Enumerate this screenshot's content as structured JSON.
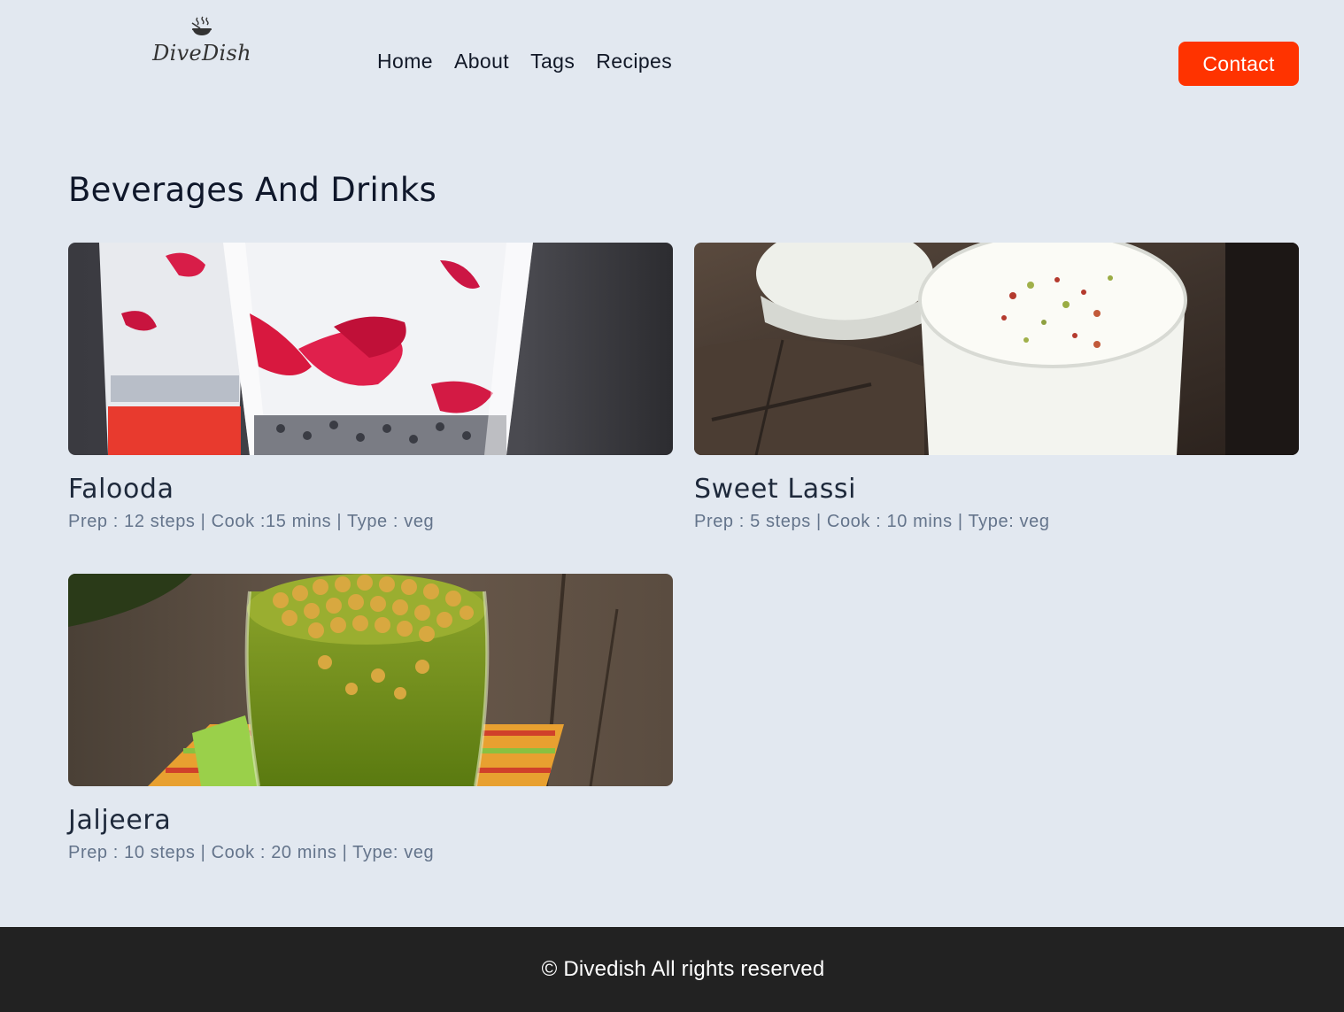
{
  "brand": {
    "name": "DiveDish",
    "icon": "cooking-pot-icon"
  },
  "nav": {
    "links": [
      {
        "label": "Home"
      },
      {
        "label": "About"
      },
      {
        "label": "Tags"
      },
      {
        "label": "Recipes"
      }
    ],
    "contact_label": "Contact"
  },
  "colors": {
    "background": "#e2e8f0",
    "accent": "#ff3300",
    "footer_bg": "#222222",
    "meta_text": "#64748b"
  },
  "main": {
    "title": "Beverages And Drinks",
    "recipes": [
      {
        "name": "Falooda",
        "meta": "Prep : 12 steps | Cook :15 mins | Type : veg"
      },
      {
        "name": "Sweet Lassi",
        "meta": "Prep : 5 steps | Cook : 10 mins | Type: veg"
      },
      {
        "name": "Jaljeera",
        "meta": "Prep : 10 steps | Cook : 20 mins | Type: veg"
      }
    ]
  },
  "footer": {
    "text": "© Divedish All rights reserved"
  }
}
